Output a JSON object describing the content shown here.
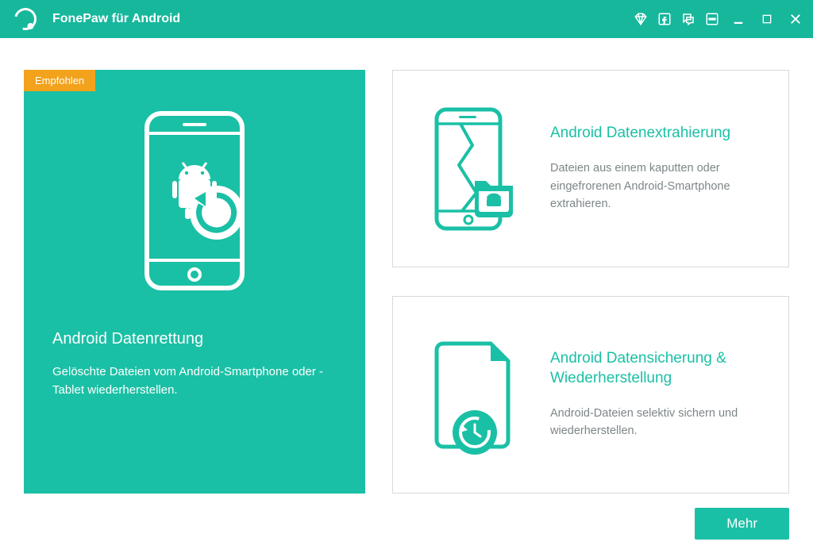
{
  "app": {
    "title": "FonePaw für Android"
  },
  "icons": {
    "diamond": "diamond-icon",
    "facebook": "facebook-icon",
    "chat": "chat-icon",
    "menu": "menu-icon"
  },
  "colors": {
    "accent": "#1ac0a5",
    "badge": "#f2a21b",
    "border": "#d7d9d9",
    "muted": "#7d8688"
  },
  "main_card": {
    "badge": "Empfohlen",
    "title": "Android Datenrettung",
    "desc": "Gelöschte Dateien vom Android-Smartphone oder -Tablet wiederherstellen."
  },
  "secondary": [
    {
      "title": "Android Datenextrahierung",
      "desc": "Dateien aus einem kaputten oder eingefrorenen Android-Smartphone extrahieren."
    },
    {
      "title": "Android Datensicherung & Wiederherstellung",
      "desc": "Android-Dateien selektiv sichern und wiederherstellen."
    }
  ],
  "footer": {
    "more_label": "Mehr"
  }
}
